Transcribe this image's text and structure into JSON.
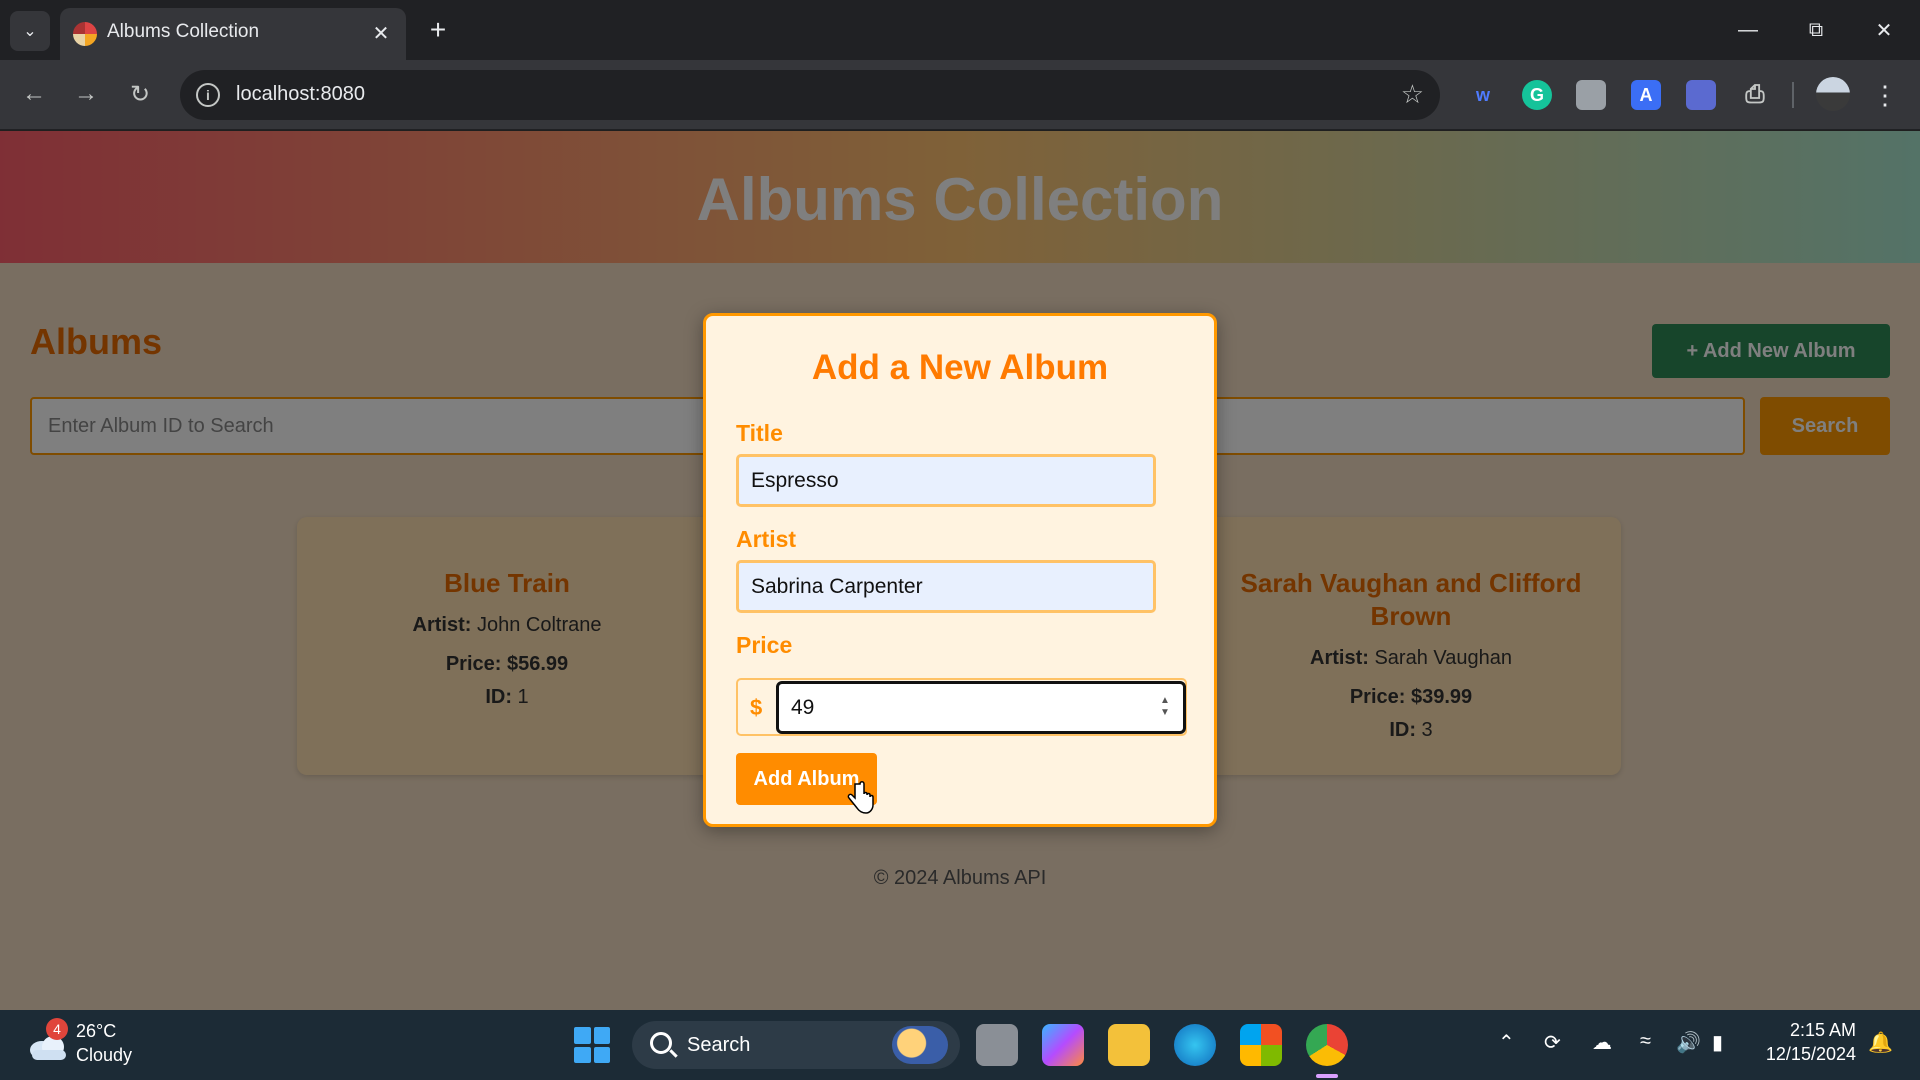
{
  "browser": {
    "tab_title": "Albums Collection",
    "url": "localhost:8080"
  },
  "page": {
    "site_title": "Albums Collection",
    "heading": "Albums",
    "add_new_button": "+ Add New Album",
    "search_placeholder": "Enter Album ID to Search",
    "search_button": "Search",
    "artist_label": "Artist:",
    "price_label": "Price:",
    "id_label": "ID:",
    "albums": [
      {
        "title": "Blue Train",
        "artist": "John Coltrane",
        "price": "$56.99",
        "id": "1"
      },
      {
        "title": "Sarah Vaughan and Clifford Brown",
        "artist": "Sarah Vaughan",
        "price": "$39.99",
        "id": "3"
      }
    ],
    "footer": "© 2024 Albums API"
  },
  "modal": {
    "title": "Add a New Album",
    "title_label": "Title",
    "title_value": "Espresso",
    "artist_label": "Artist",
    "artist_value": "Sabrina Carpenter",
    "price_label": "Price",
    "currency": "$",
    "price_value": "49",
    "submit_button": "Add Album"
  },
  "taskbar": {
    "weather_badge": "4",
    "temperature": "26°C",
    "condition": "Cloudy",
    "search_label": "Search",
    "time": "2:15 AM",
    "date": "12/15/2024"
  },
  "colors": {
    "accent_orange": "#ff8c00",
    "add_new_green": "#2e8b57",
    "header_gradient": [
      "#ff5f6d",
      "#ffc371",
      "#a8e6cf"
    ]
  },
  "icons": [
    "tab-list-icon",
    "favicon-icon",
    "close-icon",
    "plus-icon",
    "minimize-icon",
    "restore-icon",
    "back-icon",
    "forward-icon",
    "reload-icon",
    "info-icon",
    "star-icon",
    "extensions-icon",
    "kebab-menu-icon",
    "hand-cursor-icon",
    "windows-start-icon",
    "search-icon",
    "wifi-icon",
    "volume-icon",
    "battery-icon",
    "bell-icon"
  ]
}
